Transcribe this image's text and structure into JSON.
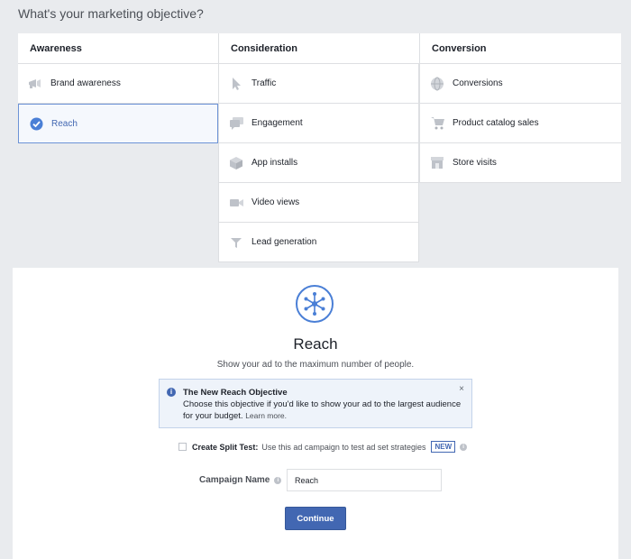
{
  "header": {
    "title": "What's your marketing objective?"
  },
  "columns": [
    {
      "heading": "Awareness",
      "options": [
        {
          "label": "Brand awareness",
          "icon": "megaphone-icon",
          "selected": false
        },
        {
          "label": "Reach",
          "icon": "checkmark-circle-icon",
          "selected": true
        }
      ]
    },
    {
      "heading": "Consideration",
      "options": [
        {
          "label": "Traffic",
          "icon": "cursor-icon",
          "selected": false
        },
        {
          "label": "Engagement",
          "icon": "speech-bubbles-icon",
          "selected": false
        },
        {
          "label": "App installs",
          "icon": "box-icon",
          "selected": false
        },
        {
          "label": "Video views",
          "icon": "video-camera-icon",
          "selected": false
        },
        {
          "label": "Lead generation",
          "icon": "funnel-icon",
          "selected": false
        }
      ]
    },
    {
      "heading": "Conversion",
      "options": [
        {
          "label": "Conversions",
          "icon": "globe-icon",
          "selected": false
        },
        {
          "label": "Product catalog sales",
          "icon": "shopping-cart-icon",
          "selected": false
        },
        {
          "label": "Store visits",
          "icon": "store-icon",
          "selected": false
        }
      ]
    }
  ],
  "detail": {
    "icon": "reach-network-icon",
    "title": "Reach",
    "subtitle": "Show your ad to the maximum number of people."
  },
  "info": {
    "title": "The New Reach Objective",
    "body": "Choose this objective if you'd like to show your ad to the largest audience for your budget.",
    "link": "Learn more.",
    "close": "×"
  },
  "split_test": {
    "label": "Create Split Test:",
    "description": "Use this ad campaign to test ad set strategies",
    "badge": "NEW"
  },
  "campaign": {
    "label": "Campaign Name",
    "value": "Reach"
  },
  "actions": {
    "continue_label": "Continue"
  },
  "colors": {
    "accent": "#4267b2",
    "selected_border": "#6d93d6",
    "icon_gray": "#bec2c9"
  }
}
